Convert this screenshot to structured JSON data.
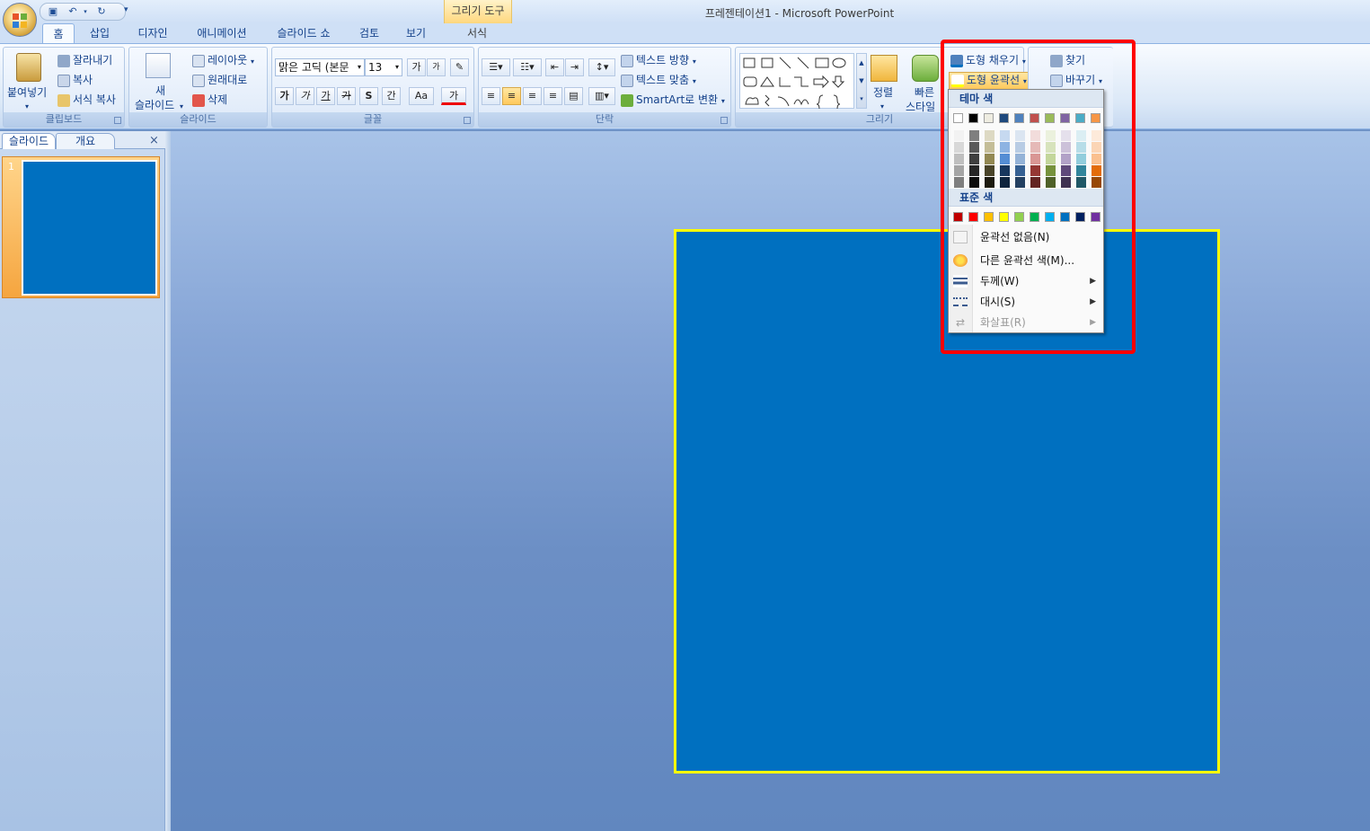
{
  "window": {
    "title": "프레젠테이션1 - Microsoft PowerPoint",
    "context_tab_group": "그리기 도구"
  },
  "tabs": [
    "홈",
    "삽입",
    "디자인",
    "애니메이션",
    "슬라이드 쇼",
    "검토",
    "보기",
    "서식"
  ],
  "ribbon": {
    "clipboard": {
      "label": "클립보드",
      "paste": "붙여넣기",
      "cut": "잘라내기",
      "copy": "복사",
      "format_painter": "서식 복사"
    },
    "slides": {
      "label": "슬라이드",
      "new_slide_line1": "새",
      "new_slide_line2": "슬라이드",
      "layout": "레이아웃",
      "reset": "원래대로",
      "delete": "삭제"
    },
    "font": {
      "label": "글꼴",
      "font_name": "맑은 고딕 (본문",
      "font_size": "13",
      "grow": "가",
      "shrink": "가",
      "bold": "가",
      "italic": "가",
      "underline": "가",
      "strike": "가",
      "shadow": "S",
      "spacing": "간",
      "case": "Aa",
      "color": "가"
    },
    "paragraph": {
      "label": "단락",
      "text_direction": "텍스트 방향",
      "align_text": "텍스트 맞춤",
      "smartart": "SmartArt로 변환"
    },
    "drawing": {
      "label": "그리기",
      "arrange": "정렬",
      "quick_styles_line1": "빠른",
      "quick_styles_line2": "스타일",
      "shape_fill": "도형 채우기",
      "shape_outline": "도형 윤곽선"
    },
    "editing": {
      "find": "찾기",
      "replace": "바꾸기"
    }
  },
  "slide_pane": {
    "tab_slides": "슬라이드",
    "tab_outline": "개요",
    "close": "×",
    "slide_number": "1"
  },
  "outline_menu": {
    "theme_colors_header": "테마 색",
    "standard_colors_header": "표준 색",
    "theme_base_colors": [
      "#ffffff",
      "#000000",
      "#eeece1",
      "#1f497d",
      "#4f81bd",
      "#c0504d",
      "#9bbb59",
      "#8064a2",
      "#4bacc6",
      "#f79646"
    ],
    "theme_shades": [
      [
        "#f2f2f2",
        "#d8d8d8",
        "#bfbfbf",
        "#a5a5a5",
        "#7f7f7f"
      ],
      [
        "#7f7f7f",
        "#595959",
        "#3f3f3f",
        "#262626",
        "#0c0c0c"
      ],
      [
        "#ddd9c3",
        "#c4bd97",
        "#938953",
        "#494429",
        "#1d1b10"
      ],
      [
        "#c6d9f0",
        "#8db3e2",
        "#548dd4",
        "#17365d",
        "#0f243e"
      ],
      [
        "#dbe5f1",
        "#b8cce4",
        "#95b3d7",
        "#366092",
        "#244061"
      ],
      [
        "#f2dcdb",
        "#e5b9b7",
        "#d99694",
        "#953734",
        "#632423"
      ],
      [
        "#ebf1dd",
        "#d7e3bc",
        "#c3d69b",
        "#76923c",
        "#4f6128"
      ],
      [
        "#e5e0ec",
        "#ccc1d9",
        "#b2a2c7",
        "#5f497a",
        "#3f3151"
      ],
      [
        "#dbeef3",
        "#b7dde8",
        "#92cddc",
        "#31859b",
        "#205867"
      ],
      [
        "#fdeada",
        "#fbd5b5",
        "#fac08f",
        "#e36c09",
        "#974806"
      ]
    ],
    "standard_colors": [
      "#c00000",
      "#ff0000",
      "#ffc000",
      "#ffff00",
      "#92d050",
      "#00b050",
      "#00b0f0",
      "#0070c0",
      "#002060",
      "#7030a0"
    ],
    "no_outline": "윤곽선 없음(N)",
    "more_colors": "다른 윤곽선 색(M)...",
    "weight": "두께(W)",
    "dashes": "대시(S)",
    "arrows": "화살표(R)"
  },
  "colors": {
    "shape_fill": "#0070c0",
    "shape_outline": "#ffff00",
    "highlight_box": "#ff0000"
  }
}
